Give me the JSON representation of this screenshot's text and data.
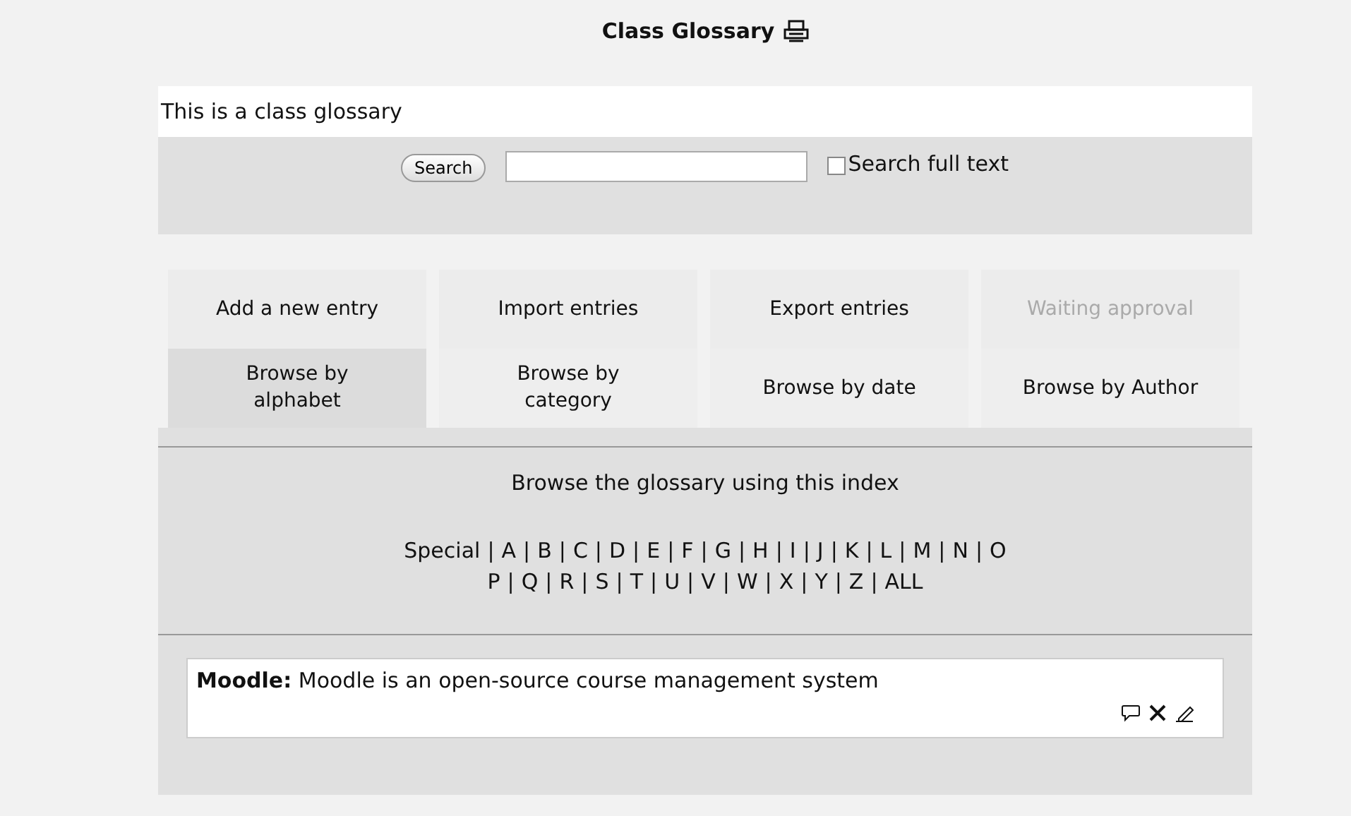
{
  "title": "Class Glossary",
  "description": "This is a class glossary",
  "search": {
    "button": "Search",
    "full_text_label": "Search full text",
    "full_text_checked": false
  },
  "actions": [
    {
      "label": "Add a new entry",
      "disabled": false
    },
    {
      "label": "Import entries",
      "disabled": false
    },
    {
      "label": "Export entries",
      "disabled": false
    },
    {
      "label": "Waiting approval",
      "disabled": true
    }
  ],
  "tabs": [
    {
      "label": "Browse by alphabet",
      "selected": true
    },
    {
      "label": "Browse by category",
      "selected": false
    },
    {
      "label": "Browse by date",
      "selected": false
    },
    {
      "label": "Browse by Author",
      "selected": false
    }
  ],
  "index": {
    "heading": "Browse the glossary using this index",
    "separator": "|",
    "line_1": [
      "Special",
      "A",
      "B",
      "C",
      "D",
      "E",
      "F",
      "G",
      "H",
      "I",
      "J",
      "K",
      "L",
      "M",
      "N",
      "O"
    ],
    "line_2": [
      "P",
      "Q",
      "R",
      "S",
      "T",
      "U",
      "V",
      "W",
      "X",
      "Y",
      "Z",
      "ALL"
    ]
  },
  "entries": [
    {
      "term": "Moodle:",
      "definition": "Moodle is an open-source course management system"
    }
  ]
}
